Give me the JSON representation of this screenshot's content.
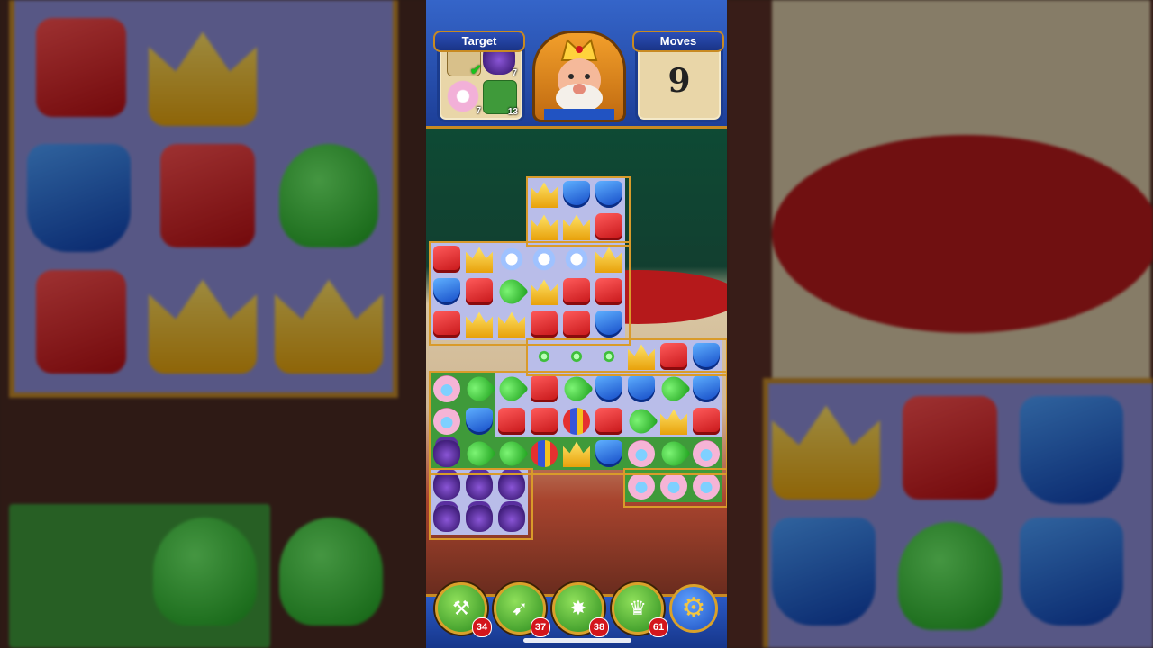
{
  "hud": {
    "target_label": "Target",
    "moves_label": "Moves",
    "moves_value": "9",
    "targets": [
      {
        "name": "scroll-target",
        "count": "",
        "done": true
      },
      {
        "name": "vase-target",
        "count": "7",
        "done": false
      },
      {
        "name": "pearl-shell-target",
        "count": "7",
        "done": false
      },
      {
        "name": "grass-target",
        "count": "13",
        "done": false
      }
    ],
    "avatar": "king-avatar"
  },
  "boosters": [
    {
      "name": "hammer-booster",
      "icon": "hammer-icon",
      "count": "34"
    },
    {
      "name": "arrow-booster",
      "icon": "arrow-icon",
      "count": "37"
    },
    {
      "name": "cannon-booster",
      "icon": "cannon-icon",
      "count": "38"
    },
    {
      "name": "jester-booster",
      "icon": "jester-hat-icon",
      "count": "61"
    }
  ],
  "settings_icon": "gear-icon",
  "colors": {
    "hud_blue": "#2a59c4",
    "frame_gold": "#c88a22",
    "board_cell": "#b9bde9",
    "grass": "#3f9a3a",
    "badge_red": "#d3161c"
  },
  "board": {
    "tile_types": [
      "red-block",
      "blue-shield",
      "green-leaf",
      "gold-crown",
      "purple-vase",
      "pearl-shell",
      "striped-ball",
      "dust-cloud",
      "leaf-spark"
    ],
    "rows": [
      [
        "",
        "",
        "",
        "gold-crown",
        "blue-shield",
        "blue-shield",
        "",
        "",
        "",
        ""
      ],
      [
        "",
        "",
        "",
        "gold-crown",
        "gold-crown",
        "red-block",
        "",
        "",
        "",
        ""
      ],
      [
        "red-block",
        "gold-crown",
        "dust-cloud",
        "dust-cloud",
        "dust-cloud",
        "gold-crown",
        "",
        "",
        "",
        ""
      ],
      [
        "blue-shield",
        "red-block",
        "green-leaf",
        "gold-crown",
        "red-block",
        "red-block",
        "",
        "",
        "",
        ""
      ],
      [
        "red-block",
        "gold-crown",
        "gold-crown",
        "red-block",
        "red-block",
        "blue-shield",
        "",
        "",
        "",
        ""
      ],
      [
        "",
        "",
        "",
        "leaf-spark",
        "leaf-spark",
        "leaf-spark",
        "gold-crown",
        "red-block",
        "blue-shield",
        ""
      ],
      [
        "pearl-shell",
        "green-leaf",
        "green-leaf",
        "red-block",
        "green-leaf",
        "blue-shield",
        "blue-shield",
        "green-leaf",
        "blue-shield",
        ""
      ],
      [
        "pearl-shell",
        "blue-shield",
        "red-block",
        "red-block",
        "striped-ball",
        "red-block",
        "green-leaf",
        "gold-crown",
        "red-block",
        ""
      ],
      [
        "purple-vase",
        "green-leaf",
        "green-leaf",
        "striped-ball",
        "gold-crown",
        "blue-shield",
        "pearl-shell",
        "green-leaf",
        "pearl-shell",
        ""
      ],
      [
        "purple-vase",
        "purple-vase",
        "purple-vase",
        "",
        "",
        "",
        "pearl-shell",
        "pearl-shell",
        "pearl-shell",
        ""
      ],
      [
        "purple-vase",
        "purple-vase",
        "purple-vase",
        "",
        "",
        "",
        "",
        "",
        "",
        ""
      ]
    ]
  }
}
